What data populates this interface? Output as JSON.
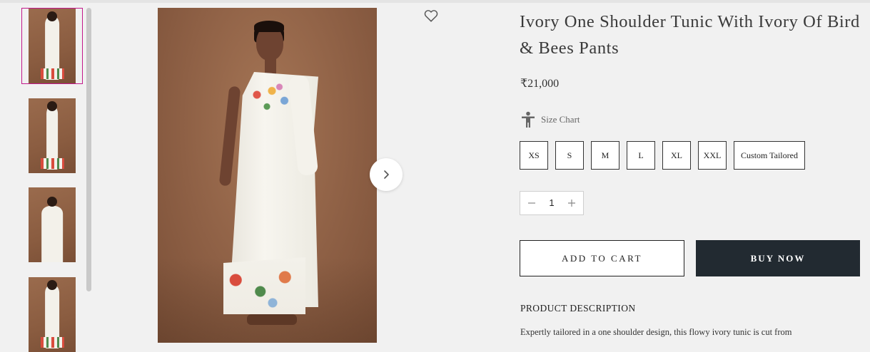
{
  "product": {
    "title": "Ivory One Shoulder Tunic With Ivory Of Bird & Bees Pants",
    "price": "₹21,000",
    "size_chart_label": "Size Chart",
    "sizes": [
      "XS",
      "S",
      "M",
      "L",
      "XL",
      "XXL",
      "Custom Tailored"
    ],
    "quantity": "1",
    "add_to_cart_label": "ADD TO CART",
    "buy_now_label": "BUY NOW",
    "description_heading": "PRODUCT DESCRIPTION",
    "description_text": "Expertly tailored in a one shoulder design, this flowy ivory tunic is cut from"
  },
  "gallery": {
    "thumbnail_count": 4,
    "active_thumbnail": 1,
    "next_icon": "chevron-right-icon",
    "wishlist_icon": "heart-outline-icon"
  },
  "colors": {
    "active_thumb_border": "#c2188b",
    "buy_now_bg": "#222a31",
    "page_bg": "#f1f1f1"
  }
}
